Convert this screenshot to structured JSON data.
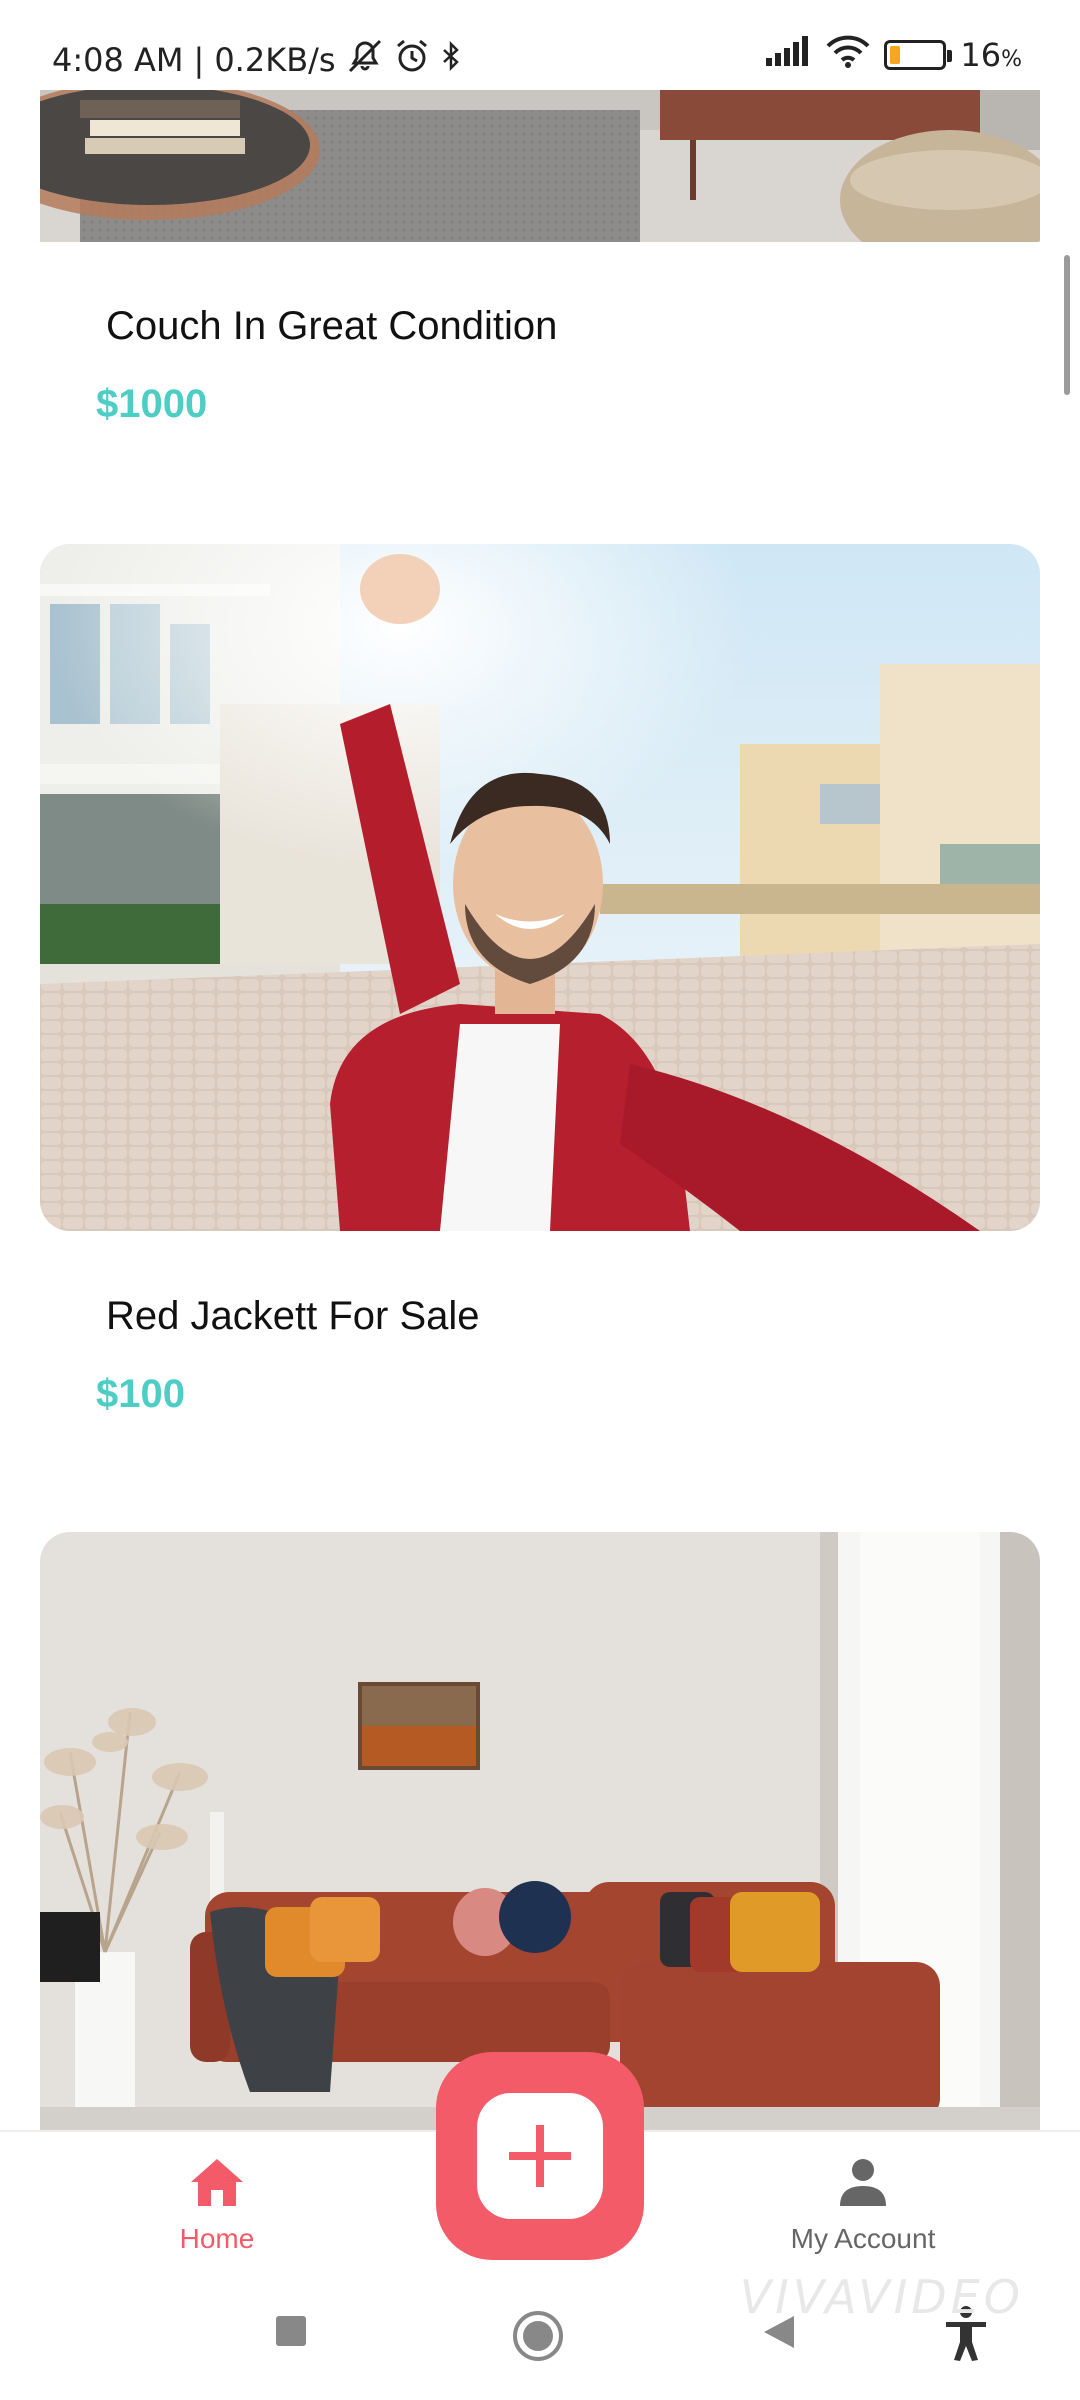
{
  "status_bar": {
    "time": "4:08 AM",
    "speed": "0.2KB/s",
    "battery": "16",
    "battery_unit": "%",
    "battery_level": 0.16,
    "icons": [
      "muted-alarm-icon",
      "alarm-clock-icon",
      "bluetooth-icon",
      "signal-icon",
      "wifi-icon",
      "battery-icon"
    ]
  },
  "listings": [
    {
      "title": "Couch In Great Condition",
      "price": "$1000",
      "image": "living-room-couch-photo"
    },
    {
      "title": "Red Jackett For Sale",
      "price": "$100",
      "image": "man-red-jacket-selfie-photo"
    },
    {
      "title": "",
      "price": "",
      "image": "orange-sectional-sofa-photo"
    }
  ],
  "bottom_nav": {
    "home_label": "Home",
    "account_label": "My Account",
    "add_icon": "plus-icon"
  },
  "colors": {
    "accent": "#f45b69",
    "price": "#4ecdc4",
    "inactive": "#666666"
  },
  "watermark": "VIVAVIDEO"
}
